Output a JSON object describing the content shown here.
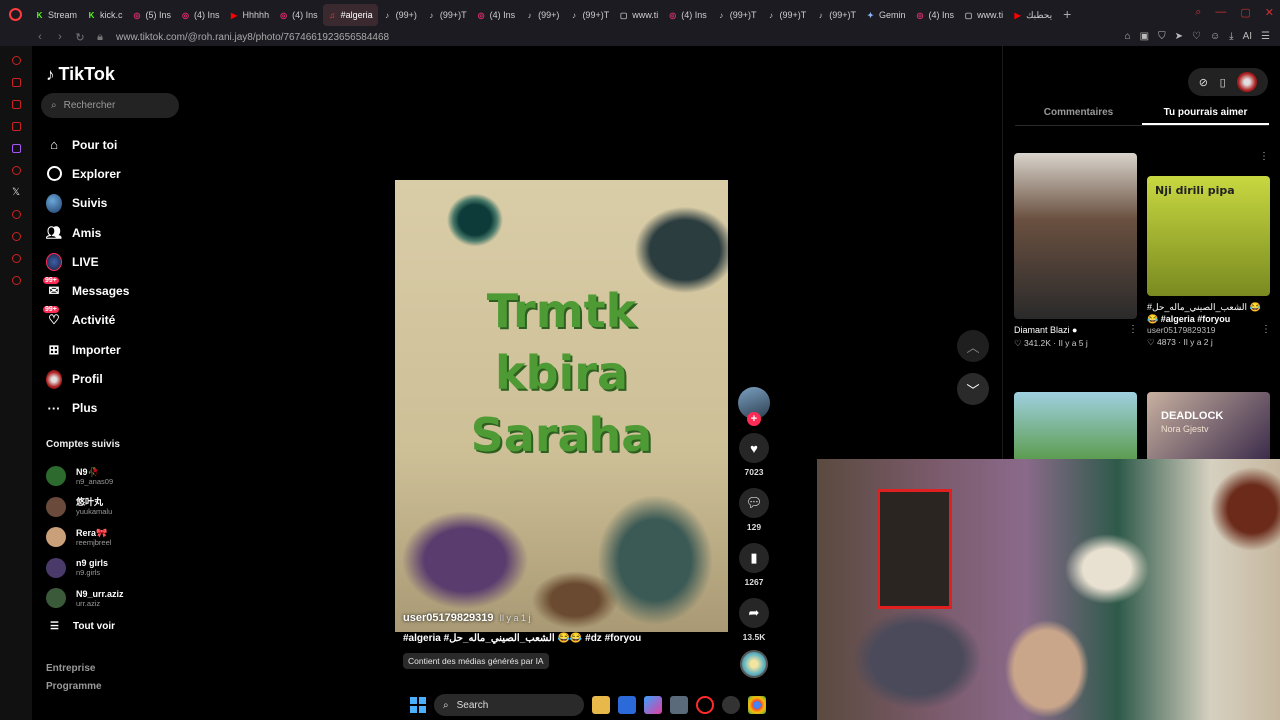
{
  "browser": {
    "tabs": [
      {
        "label": "Stream",
        "color": "#53fc18",
        "glyph": "K"
      },
      {
        "label": "kick.c",
        "color": "#53fc18",
        "glyph": "K"
      },
      {
        "label": "(5) Ins",
        "color": "#e1306c",
        "glyph": "◎"
      },
      {
        "label": "(4) Ins",
        "color": "#e1306c",
        "glyph": "◎"
      },
      {
        "label": "Hhhhh",
        "color": "#ff0000",
        "glyph": "▶"
      },
      {
        "label": "(4) Ins",
        "color": "#e1306c",
        "glyph": "◎"
      },
      {
        "label": "#algeria",
        "color": "#ff3b3b",
        "glyph": "♫",
        "active": true
      },
      {
        "label": "(99+)",
        "color": "#ffffff",
        "glyph": "♪"
      },
      {
        "label": "(99+)T",
        "color": "#ffffff",
        "glyph": "♪"
      },
      {
        "label": "(4) Ins",
        "color": "#e1306c",
        "glyph": "◎"
      },
      {
        "label": "(99+)",
        "color": "#ffffff",
        "glyph": "♪"
      },
      {
        "label": "(99+)T",
        "color": "#ffffff",
        "glyph": "♪"
      },
      {
        "label": "www.ti",
        "color": "#bbbbbb",
        "glyph": "▢"
      },
      {
        "label": "(4) Ins",
        "color": "#e1306c",
        "glyph": "◎"
      },
      {
        "label": "(99+)T",
        "color": "#ffffff",
        "glyph": "♪"
      },
      {
        "label": "(99+)T",
        "color": "#ffffff",
        "glyph": "♪"
      },
      {
        "label": "(99+)T",
        "color": "#ffffff",
        "glyph": "♪"
      },
      {
        "label": "Gemin",
        "color": "#8ab4f8",
        "glyph": "✦"
      },
      {
        "label": "(4) Ins",
        "color": "#e1306c",
        "glyph": "◎"
      },
      {
        "label": "www.ti",
        "color": "#bbbbbb",
        "glyph": "▢"
      },
      {
        "label": "يحطبك",
        "color": "#ff0000",
        "glyph": "▶"
      }
    ],
    "url": "www.tiktok.com/@roh.rani.jay8/photo/7674661923656584468",
    "ai_label": "AI"
  },
  "sidebar": {
    "logo": "TikTok",
    "search_placeholder": "Rechercher",
    "nav": [
      {
        "label": "Pour toi",
        "icon": "home-icon"
      },
      {
        "label": "Explorer",
        "icon": "compass-icon"
      },
      {
        "label": "Suivis",
        "icon": "following-avatar-icon"
      },
      {
        "label": "Amis",
        "icon": "friends-icon"
      },
      {
        "label": "LIVE",
        "icon": "live-icon"
      },
      {
        "label": "Messages",
        "icon": "messages-icon",
        "badge": "99+"
      },
      {
        "label": "Activité",
        "icon": "activity-icon",
        "badge": "99+"
      },
      {
        "label": "Importer",
        "icon": "upload-icon"
      },
      {
        "label": "Profil",
        "icon": "profile-icon"
      },
      {
        "label": "Plus",
        "icon": "more-icon"
      }
    ],
    "following_title": "Comptes suivis",
    "following": [
      {
        "name": "N9🥀",
        "handle": "n9_anas09",
        "color": "#2d6a2d"
      },
      {
        "name": "悠叶丸",
        "handle": "yuukamalu",
        "color": "#6a4a3a"
      },
      {
        "name": "Rera🎀",
        "handle": "reemjbreel",
        "color": "#c9a07a"
      },
      {
        "name": "n9 girls",
        "handle": "n9.girls",
        "color": "#4a3a6a"
      },
      {
        "name": "N9_urr.aziz",
        "handle": "urr.aziz",
        "color": "#3a5a3a"
      }
    ],
    "see_all": "Tout voir",
    "footer": [
      "Entreprise",
      "Programme"
    ]
  },
  "post": {
    "image_text": [
      "Trmtk",
      "kbira",
      "Saraha"
    ],
    "username": "user05179829319",
    "time": "Il y a 1 j",
    "caption": "#algeria #الشعب_الصيني_ماله_حل 😂😂 #dz #foryou",
    "ai_label": "Contient des médias générés par IA",
    "likes": "7023",
    "comments": "129",
    "saves": "1267",
    "shares": "13.5K"
  },
  "right_panel": {
    "tabs": [
      "Commentaires",
      "Tu pourrais aimer"
    ],
    "active_tab": 1,
    "cards": [
      {
        "title": "Diamant Blazi ●",
        "user": "",
        "likes": "341.2K",
        "age": "Il y a 5 j",
        "thumb": "#4a4a4a"
      },
      {
        "title": "#الشعب_الصيني_ماله_حل 😂",
        "subtitle": "😂 #algeria #foryou",
        "user": "user05179829319",
        "likes": "4873",
        "age": "Il y a 2 j",
        "thumb": "#b8c830",
        "thumb_text": "Nji dirili pipa"
      },
      {
        "title": "",
        "user": "",
        "likes": "",
        "age": "",
        "thumb": "#6aa86a"
      },
      {
        "title": "",
        "user": "",
        "likes": "",
        "age": "",
        "thumb": "#4a3a5a",
        "thumb_text": "DEADLOCK",
        "thumb_sub": "Nora Gjestv"
      }
    ]
  },
  "taskbar": {
    "search_label": "Search"
  }
}
